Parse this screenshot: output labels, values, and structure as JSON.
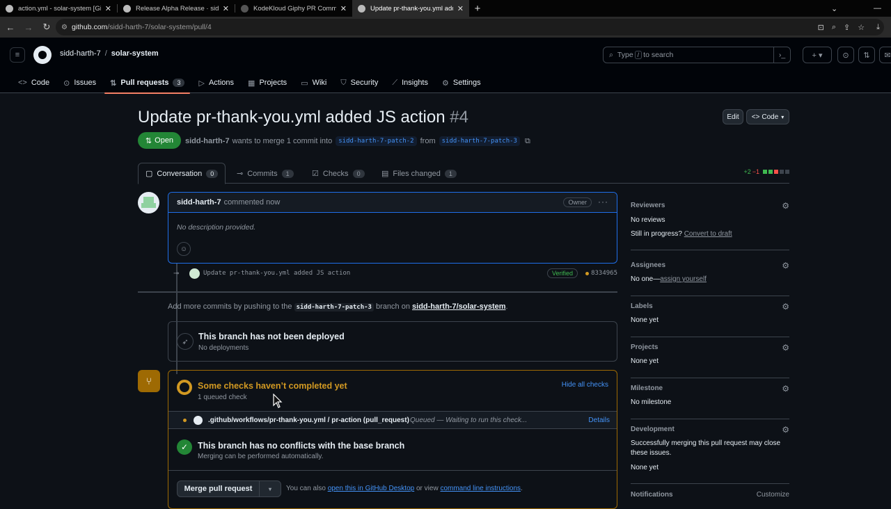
{
  "browser": {
    "tabs": [
      {
        "title": "action.yml - solar-system [GitHu",
        "active": false
      },
      {
        "title": "Release Alpha Release · sidd-har",
        "active": false
      },
      {
        "title": "KodeKloud Giphy PR Comment",
        "active": false
      },
      {
        "title": "Update pr-thank-you.yml added",
        "active": true
      }
    ],
    "url_host": "github.com",
    "url_path": "/sidd-harth-7/solar-system/pull/4"
  },
  "header": {
    "owner": "sidd-harth-7",
    "repo": "solar-system",
    "search_prefix": "Type",
    "search_key": "/",
    "search_suffix": "to search"
  },
  "repo_nav": {
    "code": "Code",
    "issues": "Issues",
    "pull_requests": "Pull requests",
    "pull_requests_count": "3",
    "actions": "Actions",
    "projects": "Projects",
    "wiki": "Wiki",
    "security": "Security",
    "insights": "Insights",
    "settings": "Settings"
  },
  "pr": {
    "title": "Update pr-thank-you.yml added JS action",
    "number": "#4",
    "edit_label": "Edit",
    "code_label": "Code",
    "state": "Open",
    "author": "sidd-harth-7",
    "meta_text": "wants to merge 1 commit into",
    "base_branch": "sidd-harth-7-patch-2",
    "from_text": "from",
    "head_branch": "sidd-harth-7-patch-3"
  },
  "pr_tabs": {
    "conversation": "Conversation",
    "conversation_count": "0",
    "commits": "Commits",
    "commits_count": "1",
    "checks": "Checks",
    "checks_count": "0",
    "files": "Files changed",
    "files_count": "1",
    "additions": "+2",
    "deletions": "−1"
  },
  "comment": {
    "author": "sidd-harth-7",
    "action": "commented now",
    "role": "Owner",
    "body": "No description provided."
  },
  "commit": {
    "message": "Update pr-thank-you.yml added JS action",
    "verified": "Verified",
    "sha": "8334965"
  },
  "push_hint": {
    "prefix": "Add more commits by pushing to the",
    "branch": "sidd-harth-7-patch-3",
    "middle": "branch on",
    "repo": "sidd-harth-7/solar-system",
    "suffix": "."
  },
  "deploy": {
    "title": "This branch has not been deployed",
    "subtitle": "No deployments"
  },
  "checks": {
    "title": "Some checks haven’t completed yet",
    "subtitle": "1 queued check",
    "hide_label": "Hide all checks",
    "row_name": ".github/workflows/pr-thank-you.yml / pr-action (pull_request)",
    "row_status": "Queued — Waiting to run this check...",
    "row_details": "Details"
  },
  "conflicts": {
    "title": "This branch has no conflicts with the base branch",
    "subtitle": "Merging can be performed automatically."
  },
  "merge": {
    "button": "Merge pull request",
    "alt_prefix": "You can also",
    "alt_link1": "open this in GitHub Desktop",
    "alt_middle": "or view",
    "alt_link2": "command line instructions",
    "alt_suffix": "."
  },
  "sidebar": {
    "reviewers": {
      "label": "Reviewers",
      "value": "No reviews",
      "wip": "Still in progress?",
      "wip_link": "Convert to draft"
    },
    "assignees": {
      "label": "Assignees",
      "value": "No one—",
      "link": "assign yourself"
    },
    "labels": {
      "label": "Labels",
      "value": "None yet"
    },
    "projects": {
      "label": "Projects",
      "value": "None yet"
    },
    "milestone": {
      "label": "Milestone",
      "value": "No milestone"
    },
    "development": {
      "label": "Development",
      "note": "Successfully merging this pull request may close these issues.",
      "value": "None yet"
    },
    "notifications": {
      "label": "Notifications",
      "action": "Customize"
    }
  },
  "colors": {
    "bg": "#0d1117",
    "accent": "#4493f8",
    "open_green": "#238636",
    "pending": "#d29922",
    "border": "#3d444d"
  }
}
